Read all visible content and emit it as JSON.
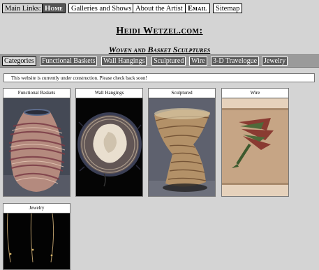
{
  "nav": {
    "label": "Main Links:",
    "items": [
      {
        "label": "Home"
      },
      {
        "label": "Galleries and Shows"
      },
      {
        "label": "About the Artist"
      },
      {
        "label": "Email"
      },
      {
        "label": "Sitemap"
      }
    ]
  },
  "header": {
    "title": "Heidi Wetzel.com:",
    "subtitle": "Woven and Basket Sculptures"
  },
  "categories": {
    "label": "Categories",
    "items": [
      {
        "label": "Functional Baskets"
      },
      {
        "label": "Wall Hangings"
      },
      {
        "label": "Sculptured"
      },
      {
        "label": "Wire"
      },
      {
        "label": "3-D Travelogue"
      },
      {
        "label": "Jewelry"
      }
    ]
  },
  "notice": "This website is currently under construction. Please check back soon!",
  "gallery": [
    {
      "caption": "Functional Baskets"
    },
    {
      "caption": "Wall Hangings"
    },
    {
      "caption": "Sculptured"
    },
    {
      "caption": "Wire"
    },
    {
      "caption": "Jewelry"
    }
  ]
}
